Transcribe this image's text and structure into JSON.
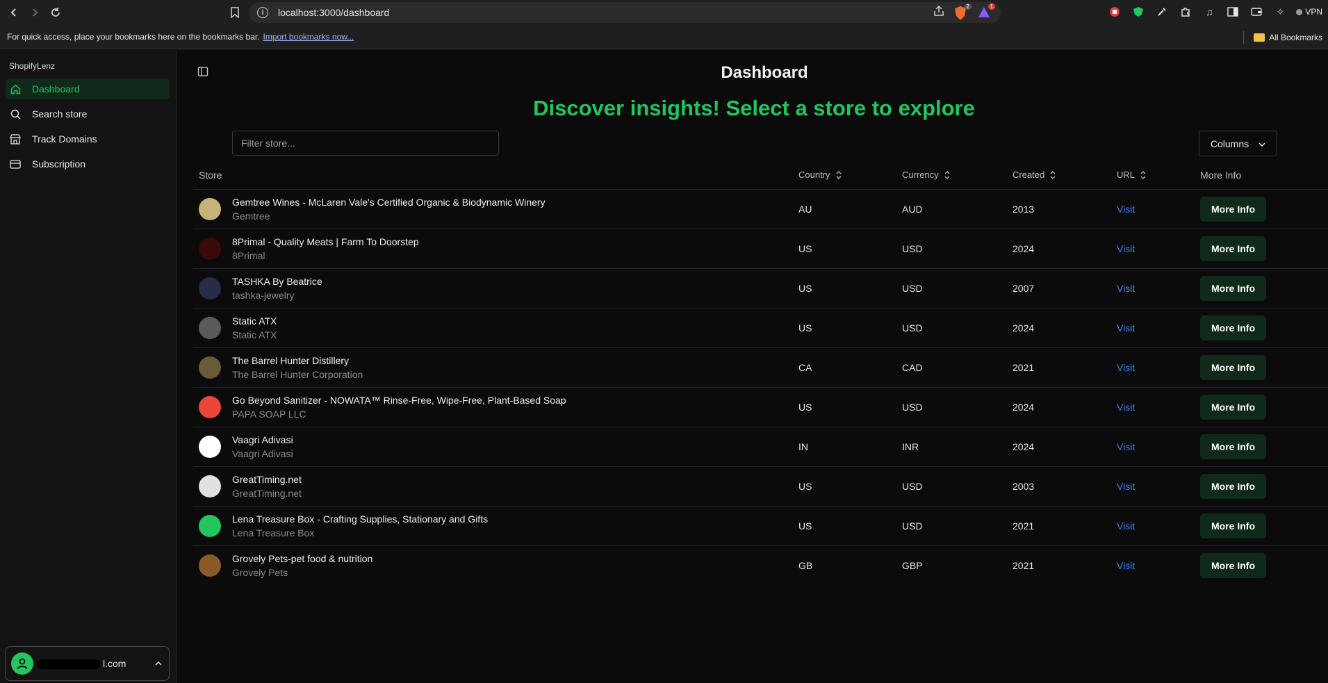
{
  "browser": {
    "url": "localhost:3000/dashboard",
    "ext_badge_1": "2",
    "ext_badge_2": "1",
    "vpn_label": "VPN",
    "bookmarks_hint": "For quick access, place your bookmarks here on the bookmarks bar.",
    "import_link": "Import bookmarks now...",
    "all_bookmarks": "All Bookmarks"
  },
  "sidebar": {
    "brand": "ShopifyLenz",
    "items": [
      {
        "label": "Dashboard",
        "icon": "home-icon",
        "active": true
      },
      {
        "label": "Search store",
        "icon": "search-icon",
        "active": false
      },
      {
        "label": "Track Domains",
        "icon": "store-icon",
        "active": false
      },
      {
        "label": "Subscription",
        "icon": "credit-card-icon",
        "active": false
      }
    ],
    "user_email_suffix": "l.com"
  },
  "main": {
    "title": "Dashboard",
    "hero": "Discover insights! Select a store to explore",
    "filter_placeholder": "Filter store...",
    "columns_label": "Columns",
    "headers": {
      "store": "Store",
      "country": "Country",
      "currency": "Currency",
      "created": "Created",
      "url": "URL",
      "more": "More Info"
    },
    "visit_label": "Visit",
    "more_label": "More Info"
  },
  "rows": [
    {
      "name": "Gemtree Wines - McLaren Vale's Certified Organic & Biodynamic Winery",
      "sub": "Gemtree",
      "country": "AU",
      "currency": "AUD",
      "created": "2013",
      "logo_color": "#c9b27a"
    },
    {
      "name": "8Primal - Quality Meats | Farm To Doorstep",
      "sub": "8Primal",
      "country": "US",
      "currency": "USD",
      "created": "2024",
      "logo_color": "#3a0a0a"
    },
    {
      "name": "TASHKA By Beatrice",
      "sub": "tashka-jewelry",
      "country": "US",
      "currency": "USD",
      "created": "2007",
      "logo_color": "#2a2a4a"
    },
    {
      "name": "Static ATX",
      "sub": "Static ATX",
      "country": "US",
      "currency": "USD",
      "created": "2024",
      "logo_color": "#5a5a5a"
    },
    {
      "name": "The Barrel Hunter Distillery",
      "sub": "The Barrel Hunter Corporation",
      "country": "CA",
      "currency": "CAD",
      "created": "2021",
      "logo_color": "#6b5a3a"
    },
    {
      "name": "Go Beyond Sanitizer - NOWATA™ Rinse-Free, Wipe-Free, Plant-Based Soap",
      "sub": "PAPA SOAP LLC",
      "country": "US",
      "currency": "USD",
      "created": "2024",
      "logo_color": "#e8473a"
    },
    {
      "name": "Vaagri Adivasi",
      "sub": "Vaagri Adivasi",
      "country": "IN",
      "currency": "INR",
      "created": "2024",
      "logo_color": "#ffffff"
    },
    {
      "name": "GreatTiming.net",
      "sub": "GreatTiming.net",
      "country": "US",
      "currency": "USD",
      "created": "2003",
      "logo_color": "#e0e0e0"
    },
    {
      "name": "Lena Treasure Box - Crafting Supplies, Stationary and Gifts",
      "sub": "Lena Treasure Box",
      "country": "US",
      "currency": "USD",
      "created": "2021",
      "logo_color": "#22c55e"
    },
    {
      "name": "Grovely Pets-pet food & nutrition",
      "sub": "Grovely Pets",
      "country": "GB",
      "currency": "GBP",
      "created": "2021",
      "logo_color": "#8a5a2a"
    }
  ]
}
